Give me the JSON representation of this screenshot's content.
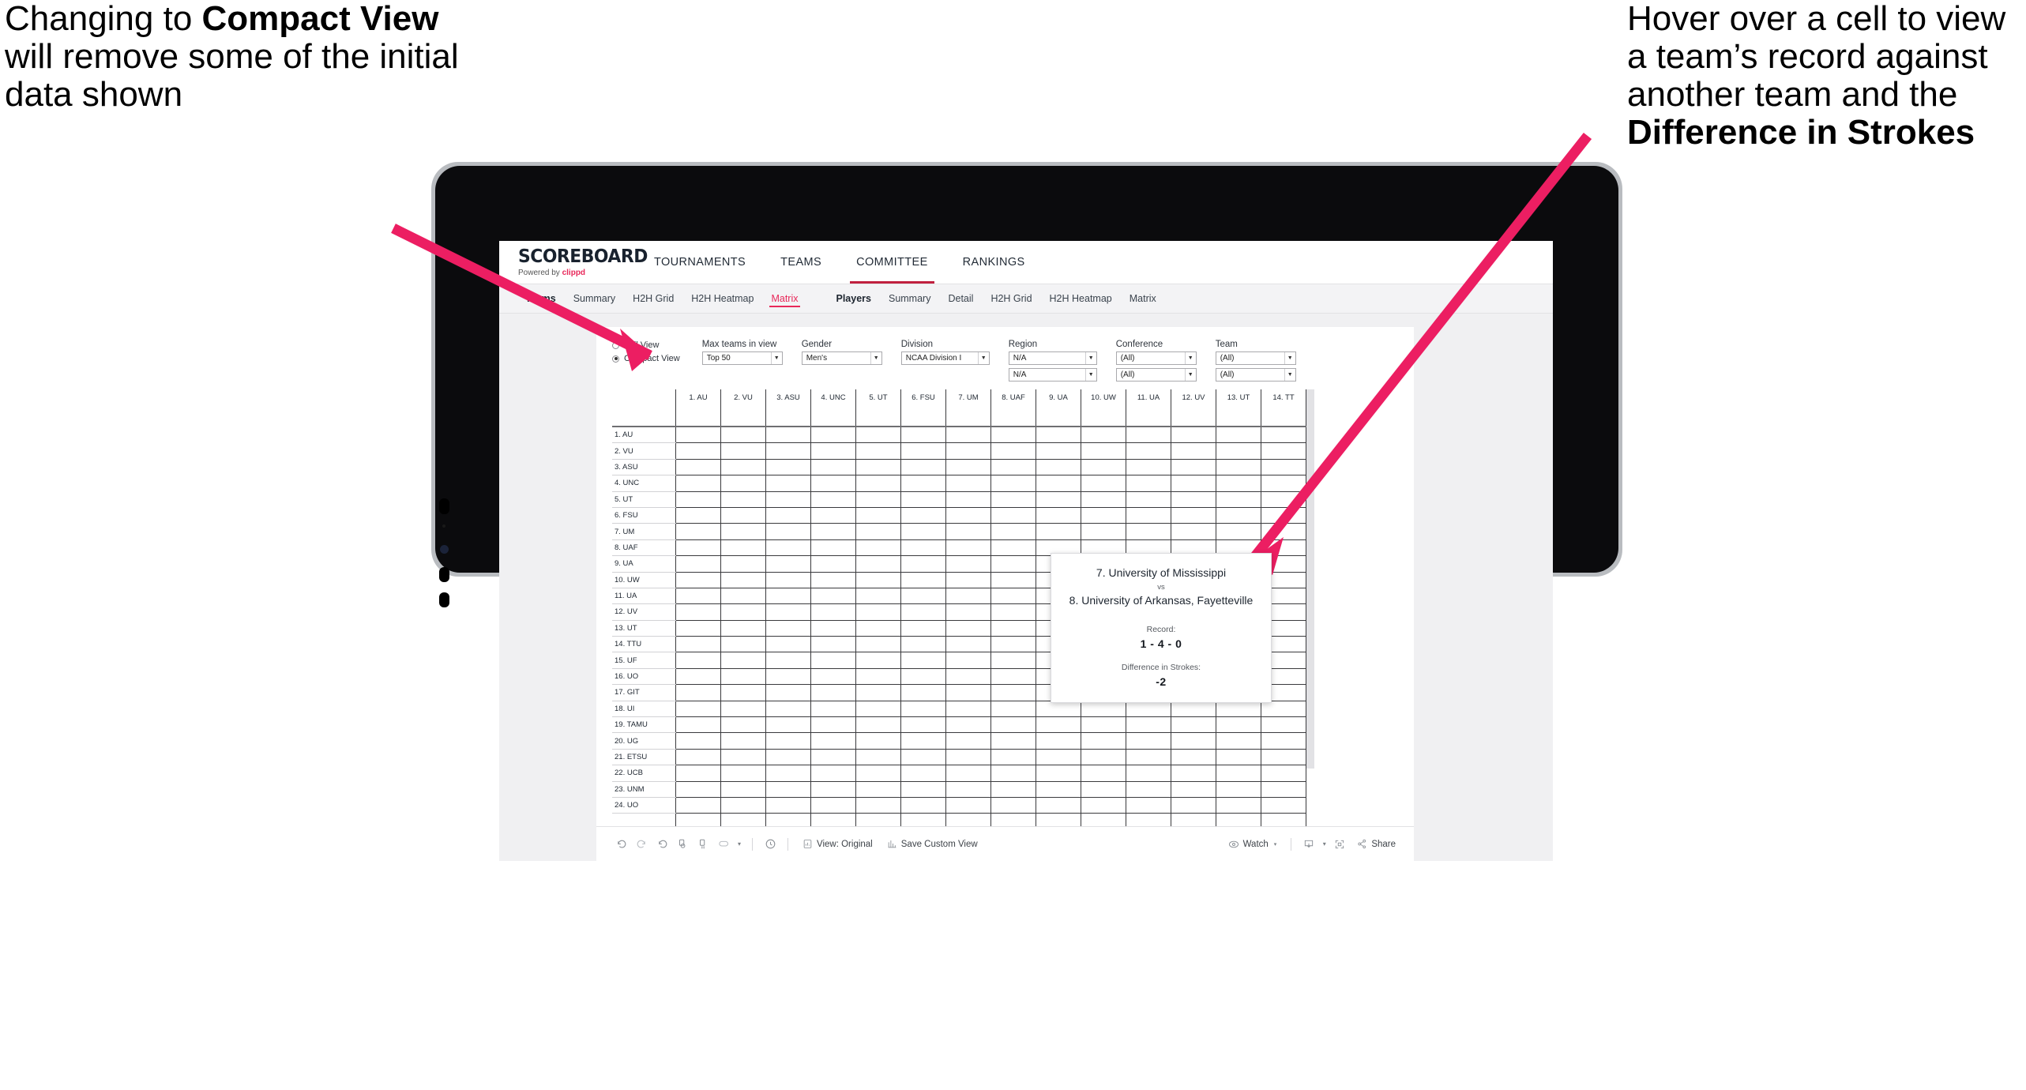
{
  "annotations": {
    "left": {
      "pre": "Changing to ",
      "bold": "Compact View",
      "post": " will remove some of the initial data shown"
    },
    "right": {
      "pre": "Hover over a cell to view a team’s record against another team and the ",
      "bold": "Difference in Strokes",
      "post": ""
    },
    "arrow_color": "#EC1E62"
  },
  "app": {
    "logo": {
      "title": "SCOREBOARD",
      "powered_prefix": "Powered by ",
      "brand": "clippd"
    },
    "topnav": [
      {
        "label": "TOURNAMENTS",
        "active": false
      },
      {
        "label": "TEAMS",
        "active": false
      },
      {
        "label": "COMMITTEE",
        "active": true
      },
      {
        "label": "RANKINGS",
        "active": false
      }
    ],
    "subnav": {
      "teams_label": "Teams",
      "teams_items": [
        {
          "label": "Summary",
          "active": false
        },
        {
          "label": "H2H Grid",
          "active": false
        },
        {
          "label": "H2H Heatmap",
          "active": false
        },
        {
          "label": "Matrix",
          "active": true
        }
      ],
      "players_label": "Players",
      "players_items": [
        {
          "label": "Summary",
          "active": false
        },
        {
          "label": "Detail",
          "active": false
        },
        {
          "label": "H2H Grid",
          "active": false
        },
        {
          "label": "H2H Heatmap",
          "active": false
        },
        {
          "label": "Matrix",
          "active": false
        }
      ]
    },
    "filters": {
      "view_options": [
        {
          "label": "Full View",
          "selected": false
        },
        {
          "label": "Compact View",
          "selected": true
        }
      ],
      "max_teams": {
        "label": "Max teams in view",
        "value": "Top 50"
      },
      "gender": {
        "label": "Gender",
        "value": "Men's"
      },
      "division": {
        "label": "Division",
        "value": "NCAA Division I"
      },
      "region": {
        "label": "Region",
        "value1": "N/A",
        "value2": "N/A"
      },
      "conference": {
        "label": "Conference",
        "value1": "(All)",
        "value2": "(All)"
      },
      "team": {
        "label": "Team",
        "value1": "(All)",
        "value2": "(All)"
      }
    },
    "tooltip": {
      "team_a": "7. University of Mississippi",
      "vs": "vs",
      "team_b": "8. University of Arkansas, Fayetteville",
      "record_label": "Record:",
      "record_value": "1 - 4 - 0",
      "diff_label": "Difference in Strokes:",
      "diff_value": "-2"
    },
    "toolbar": {
      "icons": [
        "undo-icon",
        "redo-icon",
        "revert-icon",
        "refresh-icon",
        "pause-icon",
        "alerts-icon"
      ],
      "dropdown_caret": "▾",
      "view_label": "View: Original",
      "save_label": "Save Custom View",
      "watch_label": "Watch",
      "share_label": "Share"
    },
    "matrix": {
      "columns": [
        "1. AU",
        "2. VU",
        "3. ASU",
        "4. UNC",
        "5. UT",
        "6. FSU",
        "7. UM",
        "8. UAF",
        "9. UA",
        "10. UW",
        "11. UA",
        "12. UV",
        "13. UT",
        "14. TT"
      ],
      "rows": [
        "1. AU",
        "2. VU",
        "3. ASU",
        "4. UNC",
        "5. UT",
        "6. FSU",
        "7. UM",
        "8. UAF",
        "9. UA",
        "10. UW",
        "11. UA",
        "12. UV",
        "13. UT",
        "14. TTU",
        "15. UF",
        "16. UO",
        "17. GIT",
        "18. UI",
        "19. TAMU",
        "20. UG",
        "21. ETSU",
        "22. UCB",
        "23. UNM",
        "24. UO"
      ],
      "legend": {
        "g": "win",
        "y": "loss",
        "n": "tie",
        "w": "no-result"
      },
      "colors": {
        "win": "#6B9D5C",
        "loss": "#E3C84D",
        "tie": "#D2D3D5",
        "empty": "#FFFFFF"
      },
      "cells": [
        [
          "w",
          "y",
          "y",
          "g",
          "y",
          "y",
          "y",
          "y",
          "y",
          "y",
          "w",
          "w",
          "y",
          "y"
        ],
        [
          "g",
          "w",
          "y",
          "y",
          "y",
          "y",
          "y",
          "y",
          "y",
          "y",
          "y",
          "y",
          "y",
          "y"
        ],
        [
          "g",
          "g",
          "w",
          "g",
          "y",
          "y",
          "y",
          "y",
          "y",
          "y",
          "y",
          "w",
          "y",
          "y"
        ],
        [
          "y",
          "g",
          "y",
          "w",
          "w",
          "y",
          "w",
          "g",
          "y",
          "y",
          "w",
          "y",
          "y",
          "y"
        ],
        [
          "g",
          "g",
          "g",
          "w",
          "w",
          "n",
          "y",
          "n",
          "y",
          "g",
          "y",
          "g",
          "w",
          "g"
        ],
        [
          "g",
          "g",
          "g",
          "g",
          "n",
          "w",
          "g",
          "y",
          "y",
          "g",
          "y",
          "y",
          "y",
          "n"
        ],
        [
          "g",
          "g",
          "g",
          "w",
          "g",
          "y",
          "w",
          "g",
          "y",
          "w",
          "y",
          "g",
          "w",
          "g"
        ],
        [
          "g",
          "g",
          "g",
          "y",
          "n",
          "g",
          "y",
          "w",
          "y",
          "y",
          "y",
          "y",
          "y",
          "n"
        ],
        [
          "g",
          "g",
          "g",
          "g",
          "g",
          "g",
          "g",
          "y",
          "w",
          "y",
          "y",
          "y",
          "g",
          "y"
        ],
        [
          "g",
          "w",
          "g",
          "g",
          "y",
          "y",
          "w",
          "w",
          "y",
          "w",
          "y",
          "g",
          "y",
          "n"
        ],
        [
          "w",
          "g",
          "g",
          "g",
          "g",
          "g",
          "g",
          "w",
          "y",
          "w",
          "w",
          "w",
          "y",
          "y"
        ],
        [
          "w",
          "g",
          "w",
          "g",
          "y",
          "g",
          "y",
          "w",
          "w",
          "w",
          "w",
          "w",
          "w",
          "w"
        ],
        [
          "g",
          "g",
          "g",
          "g",
          "w",
          "g",
          "w",
          "w",
          "w",
          "w",
          "w",
          "w",
          "w",
          "y"
        ],
        [
          "g",
          "g",
          "g",
          "g",
          "y",
          "n",
          "y",
          "w",
          "w",
          "w",
          "w",
          "w",
          "g",
          "w"
        ],
        [
          "g",
          "g",
          "g",
          "g",
          "g",
          "g",
          "n",
          "w",
          "w",
          "w",
          "w",
          "w",
          "g",
          "w"
        ],
        [
          "y",
          "g",
          "g",
          "n",
          "g",
          "n",
          "y",
          "w",
          "w",
          "w",
          "w",
          "g",
          "y",
          "y"
        ],
        [
          "g",
          "g",
          "g",
          "g",
          "n",
          "g",
          "w",
          "w",
          "w",
          "w",
          "w",
          "n",
          "y",
          "n"
        ],
        [
          "g",
          "w",
          "y",
          "g",
          "w",
          "g",
          "w",
          "w",
          "w",
          "w",
          "w",
          "w",
          "g",
          "y"
        ],
        [
          "g",
          "g",
          "g",
          "g",
          "y",
          "g",
          "n",
          "g",
          "y",
          "g",
          "g",
          "g",
          "n",
          "y"
        ],
        [
          "g",
          "g",
          "n",
          "g",
          "n",
          "g",
          "y",
          "g",
          "g",
          "g",
          "w",
          "g",
          "n",
          "y"
        ],
        [
          "g",
          "w",
          "w",
          "g",
          "g",
          "w",
          "g",
          "w",
          "w",
          "y",
          "w",
          "g",
          "g",
          "w"
        ],
        [
          "w",
          "g",
          "g",
          "w",
          "g",
          "g",
          "g",
          "g",
          "w",
          "g",
          "y",
          "w",
          "y",
          "g"
        ],
        [
          "g",
          "w",
          "y",
          "g",
          "w",
          "w",
          "w",
          "w",
          "w",
          "y",
          "g",
          "w",
          "g",
          "y"
        ],
        [
          "g",
          "g",
          "g",
          "g",
          "w",
          "n",
          "w",
          "w",
          "w",
          "g",
          "y",
          "w",
          "y",
          "g"
        ]
      ]
    }
  }
}
